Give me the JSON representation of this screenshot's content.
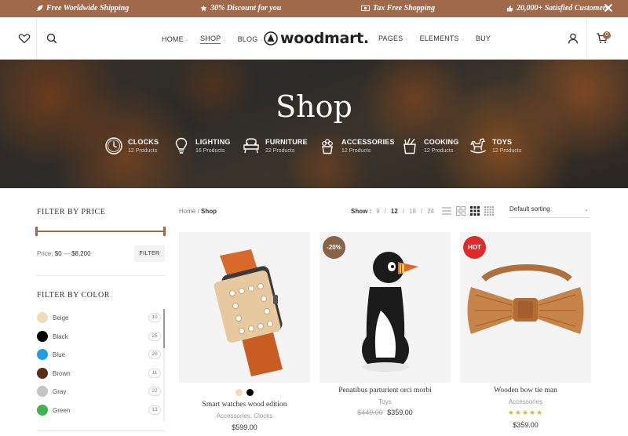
{
  "topbar": {
    "items": [
      {
        "icon": "rocket-icon",
        "text": "Free Worldwide Shipping"
      },
      {
        "icon": "star-icon",
        "text": "30% Discount for you"
      },
      {
        "icon": "money-icon",
        "text": "Tax Free Shopping"
      },
      {
        "icon": "thumbs-up-icon",
        "text": "20,000+ Satisfied Customers"
      }
    ],
    "close_icon": "close-icon",
    "background": "#a0694a"
  },
  "header": {
    "nav_left": [
      {
        "label": "HOME",
        "has_dropdown": true
      },
      {
        "label": "SHOP",
        "has_dropdown": true,
        "active": true
      },
      {
        "label": "BLOG",
        "has_dropdown": true
      }
    ],
    "logo": "woodmart.",
    "nav_right": [
      {
        "label": "PAGES",
        "has_dropdown": true
      },
      {
        "label": "ELEMENTS",
        "has_dropdown": true
      },
      {
        "label": "BUY",
        "has_dropdown": false
      }
    ],
    "cart_count": "0"
  },
  "hero": {
    "title": "Shop",
    "categories": [
      {
        "name": "CLOCKS",
        "count": "12 Products",
        "icon": "clock-icon"
      },
      {
        "name": "LIGHTING",
        "count": "16 Products",
        "icon": "lightbulb-icon"
      },
      {
        "name": "FURNITURE",
        "count": "22 Products",
        "icon": "armchair-icon"
      },
      {
        "name": "ACCESSORIES",
        "count": "12 Products",
        "icon": "plant-pot-icon"
      },
      {
        "name": "COOKING",
        "count": "12 Products",
        "icon": "kitchen-utensils-icon"
      },
      {
        "name": "TOYS",
        "count": "12 Products",
        "icon": "rocking-horse-icon"
      }
    ]
  },
  "sidebar": {
    "price_filter": {
      "title": "FILTER BY PRICE",
      "label": "Price:",
      "min": "$0",
      "separator": "—",
      "max": "$8,200",
      "button": "FILTER"
    },
    "color_filter": {
      "title": "FILTER BY COLOR",
      "colors": [
        {
          "name": "Beige",
          "count": "10",
          "swatch": "#f0dcb8"
        },
        {
          "name": "Black",
          "count": "25",
          "swatch": "#000000"
        },
        {
          "name": "Blue",
          "count": "20",
          "swatch": "#1e9fe0"
        },
        {
          "name": "Brown",
          "count": "11",
          "swatch": "#5a2d14"
        },
        {
          "name": "Gray",
          "count": "22",
          "swatch": "#c4c4c4"
        },
        {
          "name": "Green",
          "count": "13",
          "swatch": "#3fb34f"
        }
      ]
    }
  },
  "toolbar": {
    "breadcrumb": {
      "home": "Home",
      "separator": "/",
      "current": "Shop"
    },
    "show": {
      "label": "Show :",
      "options": [
        "9",
        "12",
        "18",
        "24"
      ],
      "selected": "12",
      "separator": "/"
    },
    "sort": {
      "value": "Default sorting"
    }
  },
  "products": [
    {
      "name": "Smart watches wood edition",
      "categories": "Accessories, Clocks",
      "price": "$599.00",
      "swatches": [
        "#f0dcb8",
        "#000000"
      ]
    },
    {
      "name": "Penatibus parturient orci morbi",
      "categories": "Toys",
      "old_price": "$449.00",
      "price": "$359.00",
      "badge": "-20%",
      "badge_color": "#8a6347"
    },
    {
      "name": "Wooden bow tie man",
      "categories": "Accessories",
      "price": "$359.00",
      "badge": "HOT",
      "badge_color": "#e12a2a",
      "rating": 5
    }
  ]
}
